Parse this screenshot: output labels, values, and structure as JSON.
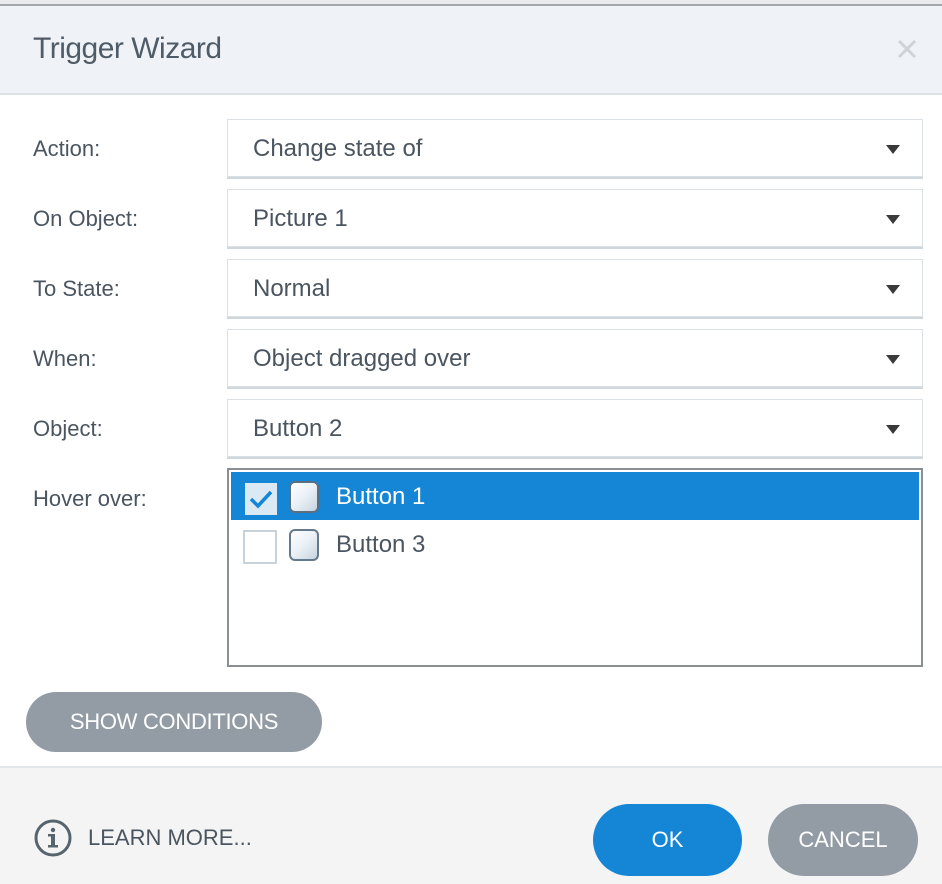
{
  "window": {
    "title": "Trigger Wizard",
    "close_icon": "close-x-icon"
  },
  "form": {
    "fields": [
      {
        "label": "Action:",
        "value": "Change state of"
      },
      {
        "label": "On Object:",
        "value": "Picture 1"
      },
      {
        "label": "To State:",
        "value": "Normal"
      },
      {
        "label": "When:",
        "value": "Object dragged over"
      },
      {
        "label": "Object:",
        "value": "Button 2"
      }
    ],
    "hover_over": {
      "label": "Hover over:",
      "items": [
        {
          "label": "Button 1",
          "checked": true,
          "selected": true,
          "icon": "button-object-icon"
        },
        {
          "label": "Button 3",
          "checked": false,
          "selected": false,
          "icon": "button-object-icon"
        }
      ]
    }
  },
  "actions": {
    "show_conditions": "SHOW CONDITIONS",
    "learn_more": "LEARN MORE...",
    "ok": "OK",
    "cancel": "CANCEL"
  },
  "colors": {
    "accent": "#1586d6",
    "secondary_button": "#939ca4",
    "header_bg": "#eff3f7",
    "footer_bg": "#f4f4f4"
  }
}
